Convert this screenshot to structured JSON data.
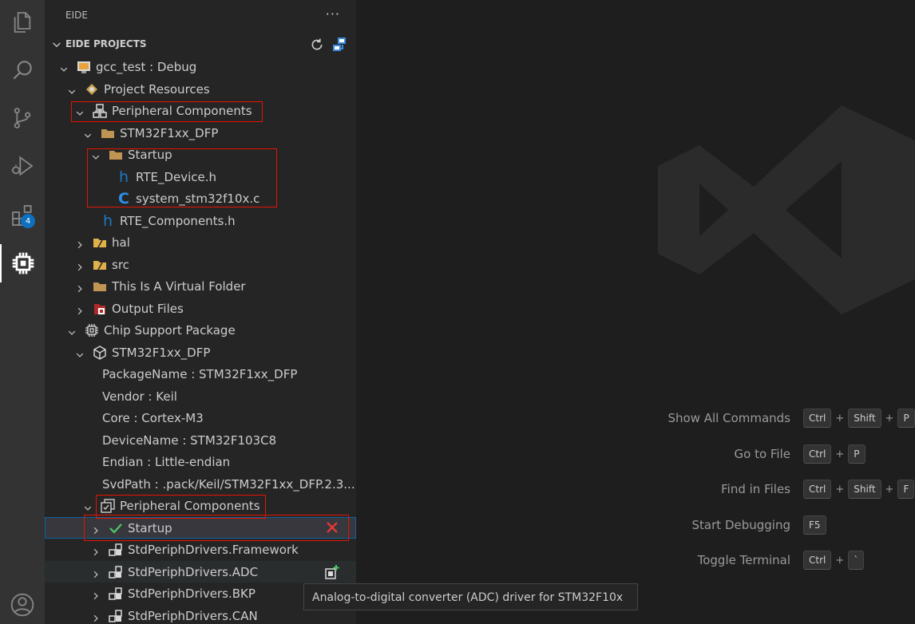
{
  "sidebar": {
    "title": "EIDE",
    "more": "···",
    "section_title": "EIDE PROJECTS"
  },
  "activity_bar": {
    "items": [
      "explorer-icon",
      "search-icon",
      "source-control-icon",
      "run-debug-icon",
      "extensions-icon",
      "eide-chip-icon",
      "account-icon"
    ],
    "extensions_badge": "4"
  },
  "tree": {
    "rows": [
      {
        "label": "gcc_test : Debug",
        "icon": "project-icon",
        "chevron": "down"
      },
      {
        "label": "Project Resources",
        "icon": "resources-icon",
        "chevron": "down"
      },
      {
        "label": "Peripheral Components",
        "icon": "components-icon",
        "chevron": "down"
      },
      {
        "label": "STM32F1xx_DFP",
        "icon": "folder-icon",
        "chevron": "down"
      },
      {
        "label": "Startup",
        "icon": "folder-icon",
        "chevron": "down"
      },
      {
        "label": "RTE_Device.h",
        "icon": "h-file-icon",
        "chevron": ""
      },
      {
        "label": "system_stm32f10x.c",
        "icon": "c-file-icon",
        "chevron": ""
      },
      {
        "label": "RTE_Components.h",
        "icon": "h-file-icon",
        "chevron": ""
      },
      {
        "label": "hal",
        "icon": "src-folder-icon",
        "chevron": "right"
      },
      {
        "label": "src",
        "icon": "src-folder-icon",
        "chevron": "right"
      },
      {
        "label": "This Is A Virtual Folder",
        "icon": "folder-icon",
        "chevron": "right"
      },
      {
        "label": "Output Files",
        "icon": "output-icon",
        "chevron": "right"
      },
      {
        "label": "Chip Support Package",
        "icon": "chip-icon",
        "chevron": "down"
      },
      {
        "label": "STM32F1xx_DFP",
        "icon": "package-icon",
        "chevron": "down"
      },
      {
        "label": "PackageName : STM32F1xx_DFP",
        "icon": "",
        "chevron": ""
      },
      {
        "label": "Vendor : Keil",
        "icon": "",
        "chevron": ""
      },
      {
        "label": "Core : Cortex-M3",
        "icon": "",
        "chevron": ""
      },
      {
        "label": "DeviceName : STM32F103C8",
        "icon": "",
        "chevron": ""
      },
      {
        "label": "Endian : Little-endian",
        "icon": "",
        "chevron": ""
      },
      {
        "label": "SvdPath : .pack/Keil/STM32F1xx_DFP.2.3....",
        "icon": "",
        "chevron": ""
      },
      {
        "label": "Peripheral Components",
        "icon": "checklist-icon",
        "chevron": "down"
      },
      {
        "label": "Startup",
        "icon": "check-icon",
        "chevron": "right"
      },
      {
        "label": "StdPeriphDrivers.Framework",
        "icon": "component-icon",
        "chevron": "right"
      },
      {
        "label": "StdPeriphDrivers.ADC",
        "icon": "component-icon",
        "chevron": "right"
      },
      {
        "label": "StdPeriphDrivers.BKP",
        "icon": "component-icon",
        "chevron": "right"
      },
      {
        "label": "StdPeriphDrivers.CAN",
        "icon": "component-icon",
        "chevron": "right"
      }
    ]
  },
  "tooltip": "Analog-to-digital converter (ADC) driver for STM32F10x",
  "shortcuts": [
    {
      "name": "Show All Commands",
      "keys": [
        "Ctrl",
        "Shift",
        "P"
      ]
    },
    {
      "name": "Go to File",
      "keys": [
        "Ctrl",
        "P"
      ]
    },
    {
      "name": "Find in Files",
      "keys": [
        "Ctrl",
        "Shift",
        "F"
      ]
    },
    {
      "name": "Start Debugging",
      "keys": [
        "F5"
      ]
    },
    {
      "name": "Toggle Terminal",
      "keys": [
        "Ctrl",
        "`"
      ]
    }
  ],
  "colors": {
    "highlight_box": "#e51400",
    "selection_border": "#0e639c",
    "folder": "#c09553",
    "h_file": "#1f78c1",
    "c_file": "#2d8fe5",
    "check": "#4ec966",
    "remove": "#e53935"
  }
}
